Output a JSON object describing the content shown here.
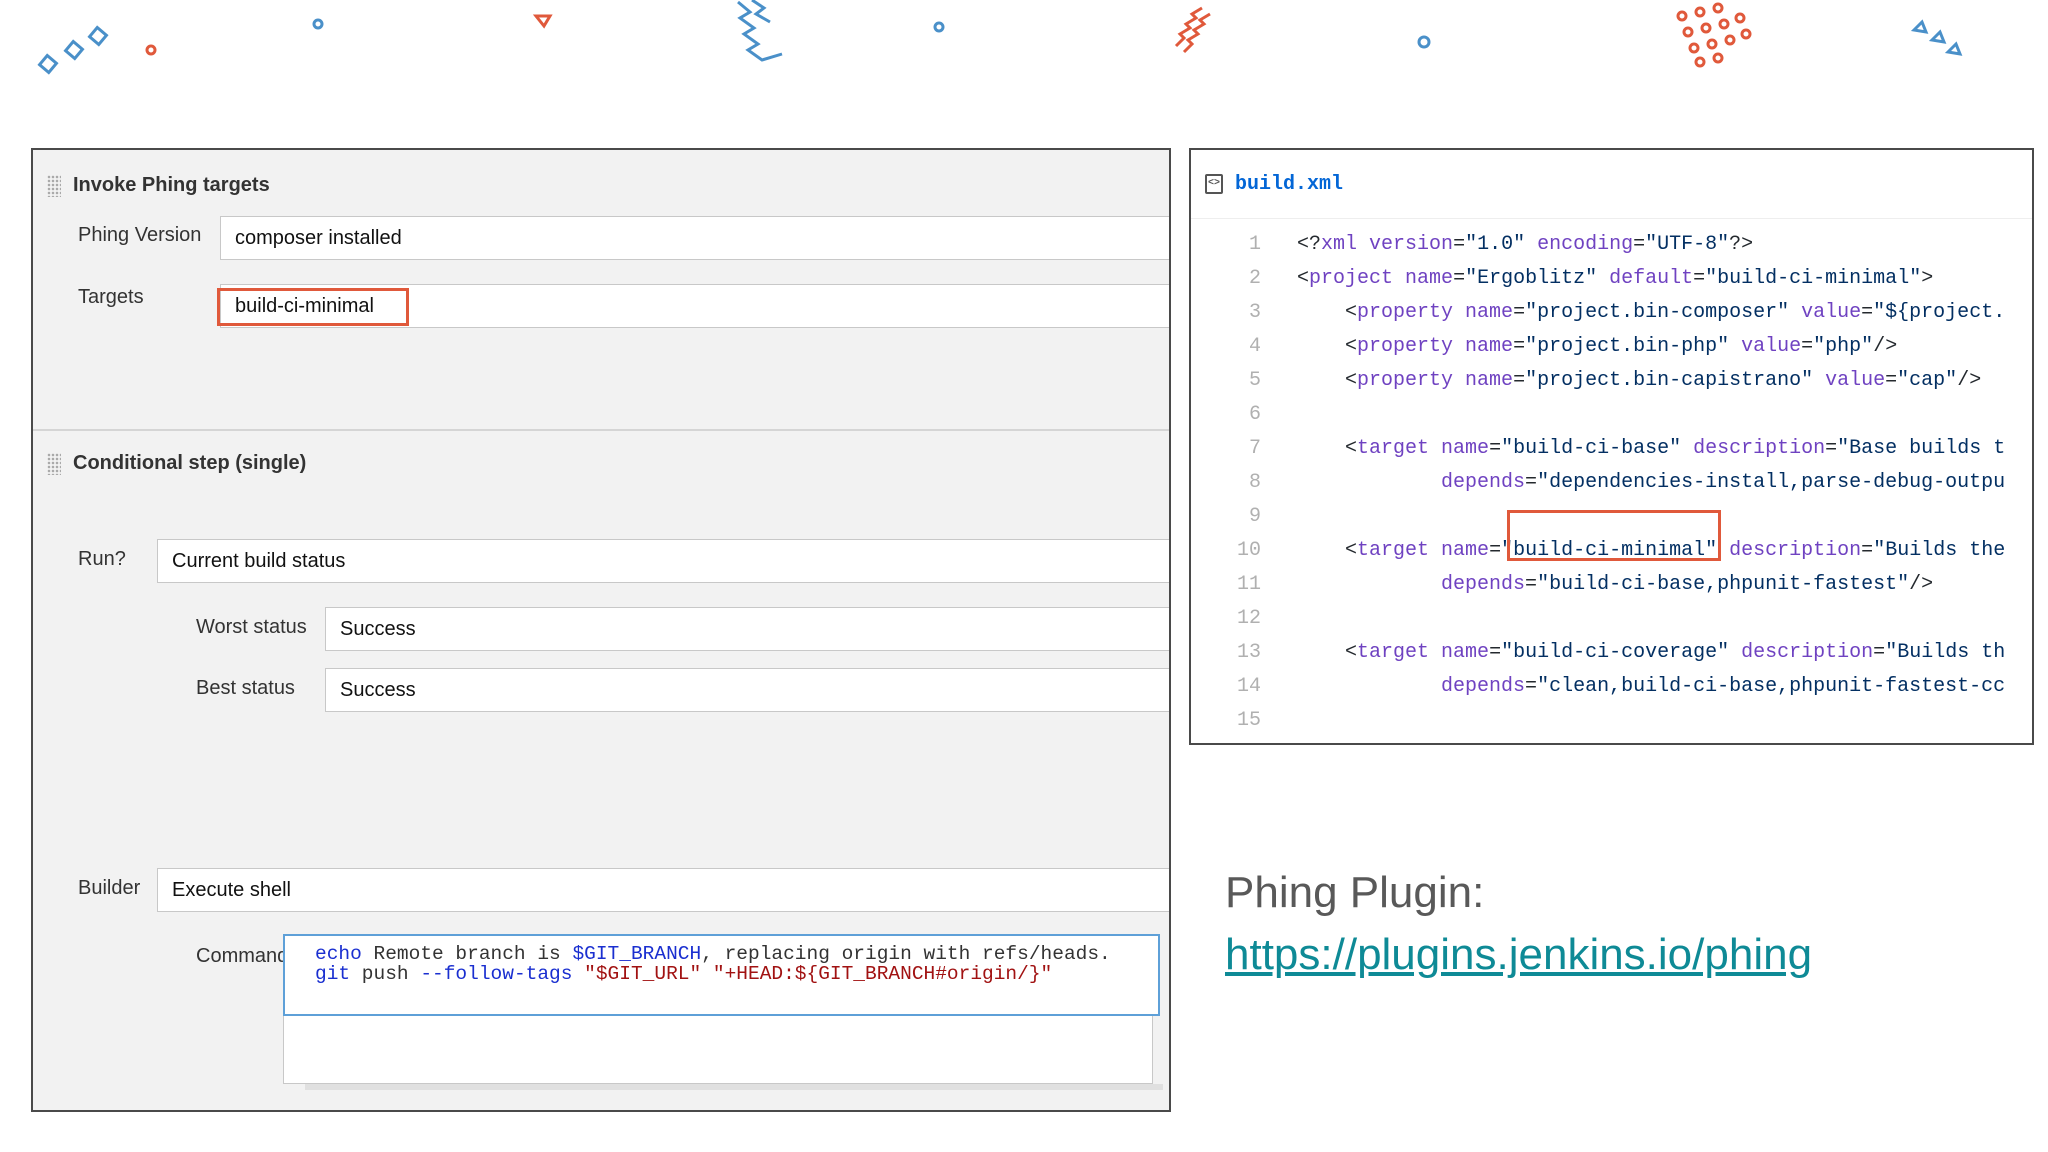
{
  "invoke_section": {
    "title": "Invoke Phing targets",
    "phing_version_label": "Phing Version",
    "phing_version_value": "composer installed",
    "targets_label": "Targets",
    "targets_value": "build-ci-minimal"
  },
  "conditional_section": {
    "title": "Conditional step (single)",
    "run_label": "Run?",
    "run_value": "Current build status",
    "worst_label": "Worst status",
    "worst_value": "Success",
    "best_label": "Best status",
    "best_value": "Success",
    "builder_label": "Builder",
    "builder_value": "Execute shell",
    "command_label": "Command"
  },
  "command": {
    "line1": {
      "kw": "echo",
      "t1": " Remote branch is ",
      "var": "$GIT_BRANCH",
      "t2": ", replacing origin with refs/heads."
    },
    "line2": {
      "kw": "git",
      "t1": " push ",
      "opt": "--follow-tags",
      "s1": " \"$GIT_URL\"",
      "s2": " \"+HEAD:${GIT_BRANCH#origin/}\""
    }
  },
  "code_panel": {
    "filename": "build.xml",
    "lines": [
      {
        "n": "1",
        "parts": [
          [
            "p",
            "<?"
          ],
          [
            "t",
            "xml"
          ],
          [
            "p",
            " "
          ],
          [
            "a",
            "version"
          ],
          [
            "p",
            "="
          ],
          [
            "s",
            "\"1.0\""
          ],
          [
            "p",
            " "
          ],
          [
            "a",
            "encoding"
          ],
          [
            "p",
            "="
          ],
          [
            "s",
            "\"UTF-8\""
          ],
          [
            "p",
            "?>"
          ]
        ]
      },
      {
        "n": "2",
        "parts": [
          [
            "p",
            "<"
          ],
          [
            "t",
            "project"
          ],
          [
            "p",
            " "
          ],
          [
            "a",
            "name"
          ],
          [
            "p",
            "="
          ],
          [
            "s",
            "\"Ergoblitz\""
          ],
          [
            "p",
            " "
          ],
          [
            "a",
            "default"
          ],
          [
            "p",
            "="
          ],
          [
            "s",
            "\"build-ci-minimal\""
          ],
          [
            "p",
            ">"
          ]
        ]
      },
      {
        "n": "3",
        "parts": [
          [
            "p",
            "    <"
          ],
          [
            "t",
            "property"
          ],
          [
            "p",
            " "
          ],
          [
            "a",
            "name"
          ],
          [
            "p",
            "="
          ],
          [
            "s",
            "\"project.bin-composer\""
          ],
          [
            "p",
            " "
          ],
          [
            "a",
            "value"
          ],
          [
            "p",
            "="
          ],
          [
            "s",
            "\"${project."
          ]
        ]
      },
      {
        "n": "4",
        "parts": [
          [
            "p",
            "    <"
          ],
          [
            "t",
            "property"
          ],
          [
            "p",
            " "
          ],
          [
            "a",
            "name"
          ],
          [
            "p",
            "="
          ],
          [
            "s",
            "\"project.bin-php\""
          ],
          [
            "p",
            " "
          ],
          [
            "a",
            "value"
          ],
          [
            "p",
            "="
          ],
          [
            "s",
            "\"php\""
          ],
          [
            "p",
            "/>"
          ]
        ]
      },
      {
        "n": "5",
        "parts": [
          [
            "p",
            "    <"
          ],
          [
            "t",
            "property"
          ],
          [
            "p",
            " "
          ],
          [
            "a",
            "name"
          ],
          [
            "p",
            "="
          ],
          [
            "s",
            "\"project.bin-capistrano\""
          ],
          [
            "p",
            " "
          ],
          [
            "a",
            "value"
          ],
          [
            "p",
            "="
          ],
          [
            "s",
            "\"cap\""
          ],
          [
            "p",
            "/>"
          ]
        ]
      },
      {
        "n": "6",
        "parts": []
      },
      {
        "n": "7",
        "parts": [
          [
            "p",
            "    <"
          ],
          [
            "t",
            "target"
          ],
          [
            "p",
            " "
          ],
          [
            "a",
            "name"
          ],
          [
            "p",
            "="
          ],
          [
            "s",
            "\"build-ci-base\""
          ],
          [
            "p",
            " "
          ],
          [
            "a",
            "description"
          ],
          [
            "p",
            "="
          ],
          [
            "s",
            "\"Base builds t"
          ]
        ]
      },
      {
        "n": "8",
        "parts": [
          [
            "p",
            "            "
          ],
          [
            "a",
            "depends"
          ],
          [
            "p",
            "="
          ],
          [
            "s",
            "\"dependencies-install,parse-debug-outpu"
          ]
        ]
      },
      {
        "n": "9",
        "parts": []
      },
      {
        "n": "10",
        "parts": [
          [
            "p",
            "    <"
          ],
          [
            "t",
            "target"
          ],
          [
            "p",
            " "
          ],
          [
            "a",
            "name"
          ],
          [
            "p",
            "="
          ],
          [
            "s",
            "\"build-ci-minimal\""
          ],
          [
            "p",
            " "
          ],
          [
            "a",
            "description"
          ],
          [
            "p",
            "="
          ],
          [
            "s",
            "\"Builds the"
          ]
        ]
      },
      {
        "n": "11",
        "parts": [
          [
            "p",
            "            "
          ],
          [
            "a",
            "depends"
          ],
          [
            "p",
            "="
          ],
          [
            "s",
            "\"build-ci-base,phpunit-fastest\""
          ],
          [
            "p",
            "/>"
          ]
        ]
      },
      {
        "n": "12",
        "parts": []
      },
      {
        "n": "13",
        "parts": [
          [
            "p",
            "    <"
          ],
          [
            "t",
            "target"
          ],
          [
            "p",
            " "
          ],
          [
            "a",
            "name"
          ],
          [
            "p",
            "="
          ],
          [
            "s",
            "\"build-ci-coverage\""
          ],
          [
            "p",
            " "
          ],
          [
            "a",
            "description"
          ],
          [
            "p",
            "="
          ],
          [
            "s",
            "\"Builds th"
          ]
        ]
      },
      {
        "n": "14",
        "parts": [
          [
            "p",
            "            "
          ],
          [
            "a",
            "depends"
          ],
          [
            "p",
            "="
          ],
          [
            "s",
            "\"clean,build-ci-base,phpunit-fastest-cc"
          ]
        ]
      },
      {
        "n": "15",
        "parts": []
      }
    ]
  },
  "plugin": {
    "title": "Phing Plugin:",
    "link": "https://plugins.jenkins.io/phing"
  },
  "colors": {
    "highlight": "#e0593b",
    "link": "#0e8a96",
    "command_border": "#5ea0d8"
  }
}
